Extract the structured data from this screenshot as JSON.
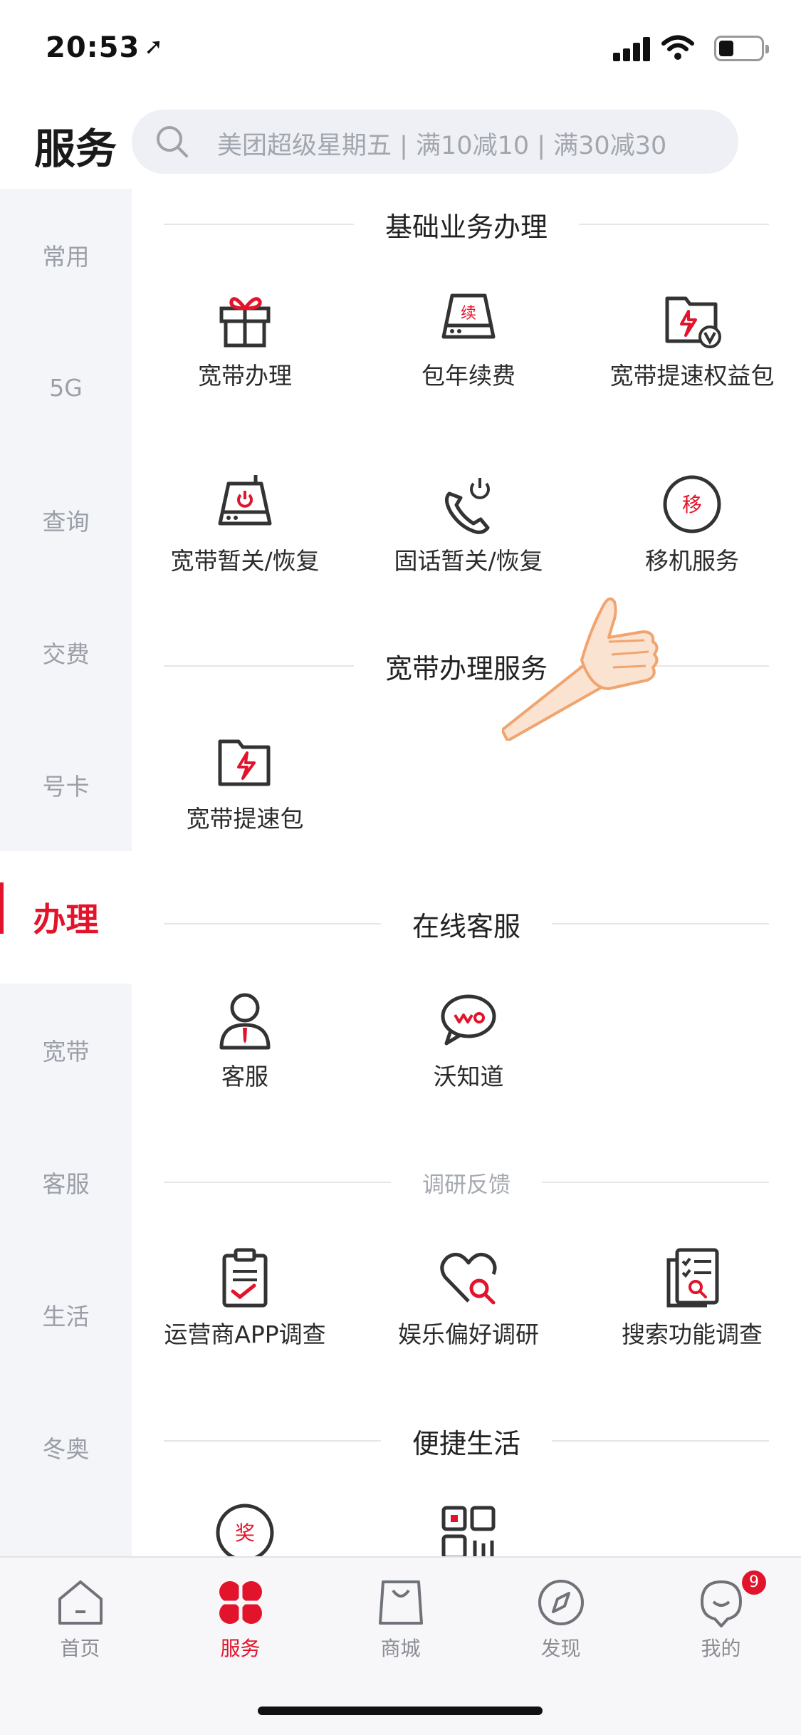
{
  "status": {
    "time": "20:53"
  },
  "header": {
    "title": "服务",
    "search_placeholder": "美团超级星期五 | 满10减10 | 满30减30"
  },
  "sidebar": {
    "items": [
      {
        "label": "常用"
      },
      {
        "label": "5G"
      },
      {
        "label": "查询"
      },
      {
        "label": "交费"
      },
      {
        "label": "号卡"
      },
      {
        "label": "办理",
        "active": true
      },
      {
        "label": "宽带"
      },
      {
        "label": "客服"
      },
      {
        "label": "生活"
      },
      {
        "label": "冬奥"
      }
    ]
  },
  "sections": {
    "basic": {
      "title": "基础业务办理",
      "items": [
        {
          "label": "宽带办理",
          "icon": "gift-icon"
        },
        {
          "label": "包年续费",
          "icon": "router-renew-icon",
          "icon_text": "续"
        },
        {
          "label": "宽带提速权益包",
          "icon": "folder-speed-vip-icon"
        },
        {
          "label": "宽带暂关/恢复",
          "icon": "router-power-icon"
        },
        {
          "label": "固话暂关/恢复",
          "icon": "phone-power-icon"
        },
        {
          "label": "移机服务",
          "icon": "move-icon",
          "icon_text": "移"
        }
      ]
    },
    "broadband": {
      "title": "宽带办理服务",
      "items": [
        {
          "label": "宽带提速包",
          "icon": "folder-speed-icon"
        }
      ]
    },
    "online": {
      "title": "在线客服",
      "items": [
        {
          "label": "客服",
          "icon": "agent-icon"
        },
        {
          "label": "沃知道",
          "icon": "chat-bubble-icon"
        }
      ]
    },
    "survey": {
      "title": "调研反馈",
      "items": [
        {
          "label": "运营商APP调查",
          "icon": "clipboard-check-icon"
        },
        {
          "label": "娱乐偏好调研",
          "icon": "heart-search-icon"
        },
        {
          "label": "搜索功能调查",
          "icon": "list-search-icon"
        }
      ]
    },
    "life": {
      "title": "便捷生活",
      "items": [
        {
          "icon": "prize-icon",
          "icon_text": "奖"
        },
        {
          "icon": "qr-code-icon"
        }
      ]
    }
  },
  "tabbar": {
    "items": [
      {
        "label": "首页",
        "icon": "home-icon"
      },
      {
        "label": "服务",
        "icon": "clover-icon",
        "active": true
      },
      {
        "label": "商城",
        "icon": "shopping-bag-icon"
      },
      {
        "label": "发现",
        "icon": "compass-icon"
      },
      {
        "label": "我的",
        "icon": "profile-icon",
        "badge": "9"
      }
    ]
  },
  "colors": {
    "accent": "#e1142b",
    "sidebar_bg": "#f4f5f9",
    "search_bg": "#eef0f5",
    "text_muted": "#9a9ea6"
  }
}
